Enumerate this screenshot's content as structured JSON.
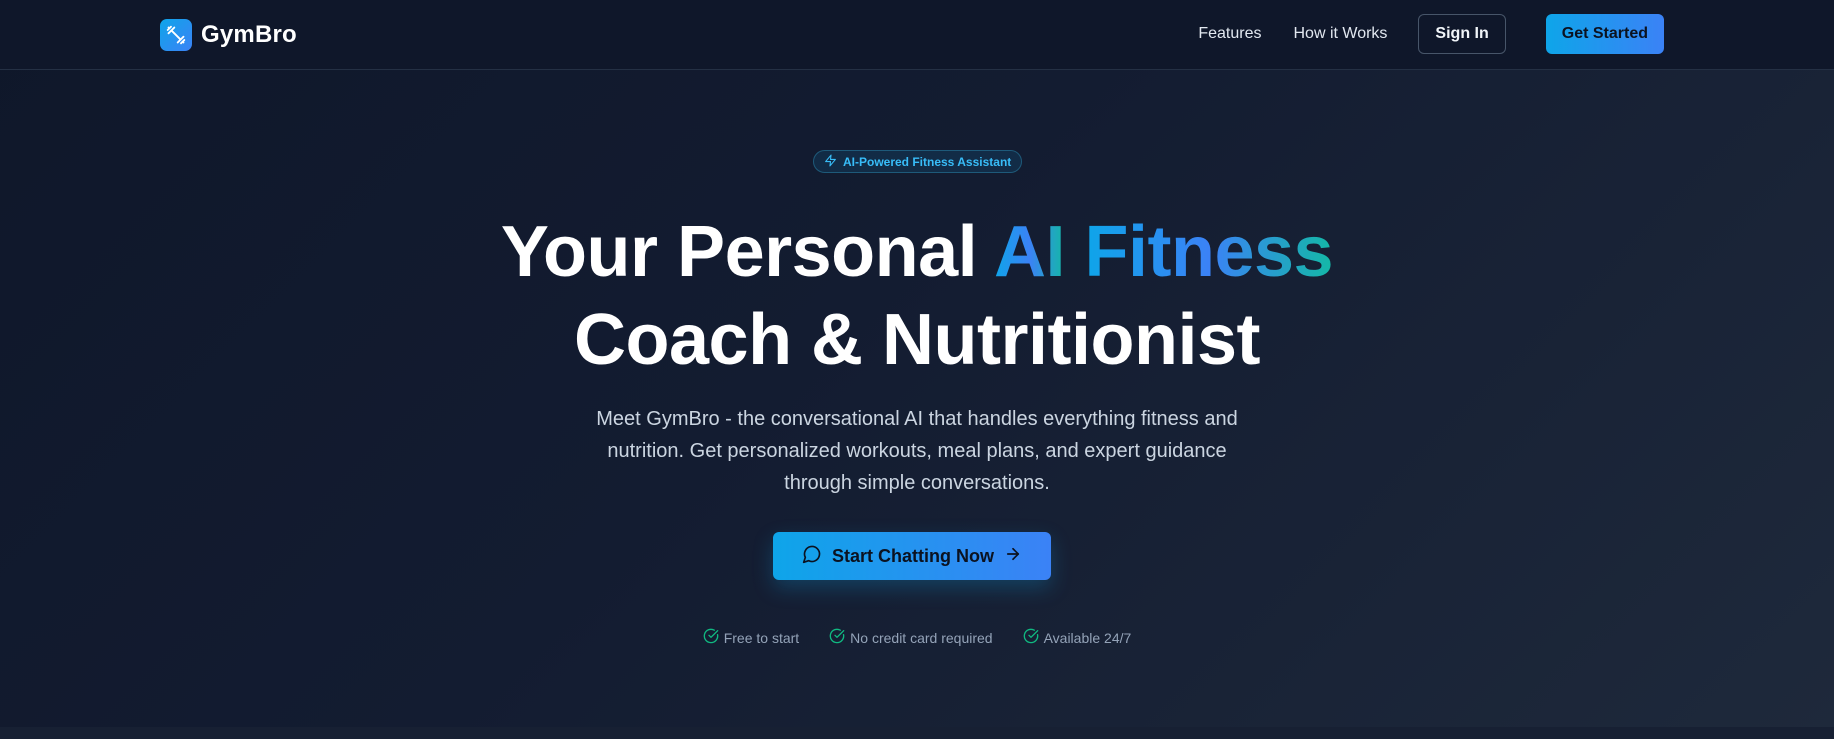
{
  "header": {
    "brand": "GymBro",
    "nav": {
      "features": "Features",
      "how_it_works": "How it Works"
    },
    "sign_in": "Sign In",
    "get_started": "Get Started"
  },
  "hero": {
    "badge": "AI-Powered Fitness Assistant",
    "headline_part1": "Your Personal ",
    "headline_highlight_ai": "AI",
    "headline_highlight_fitness": "Fitness",
    "headline_line2": "Coach & Nutritionist",
    "subtitle": "Meet GymBro - the conversational AI that handles everything fitness and nutrition. Get personalized workouts, meal plans, and expert guidance through simple conversations.",
    "cta": "Start Chatting Now",
    "perks": [
      "Free to start",
      "No credit card required",
      "Available 24/7"
    ]
  },
  "icons": {
    "logo": "dumbbell-icon",
    "badge": "lightning-icon",
    "cta_left": "chat-bubble-icon",
    "cta_right": "arrow-right-icon",
    "perk": "check-circle-icon"
  },
  "colors": {
    "background": "#0f172a",
    "accent": "#0ea5e9",
    "accent_blue": "#3b82f6",
    "accent_teal": "#14b8a6",
    "perk_check": "#10b981"
  }
}
